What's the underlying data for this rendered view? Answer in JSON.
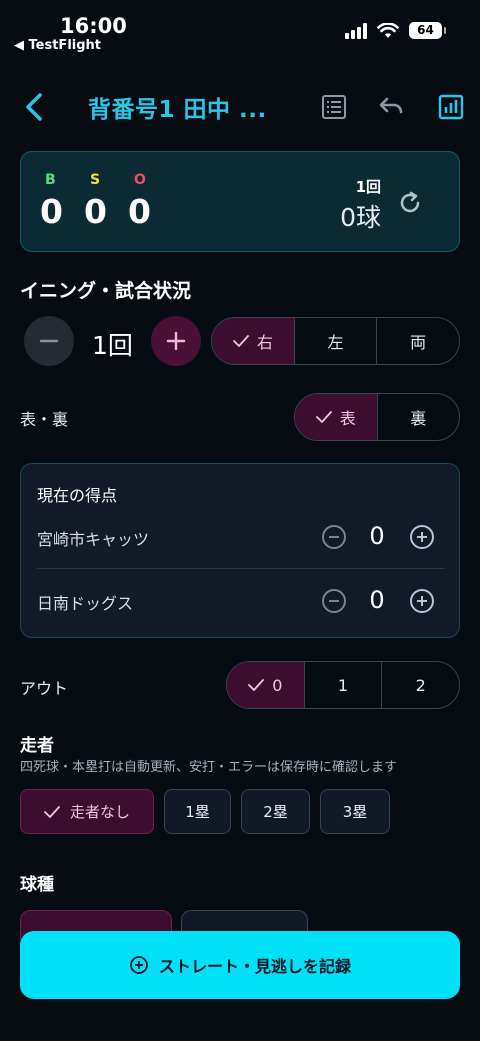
{
  "status_bar": {
    "time": "16:00",
    "back_app": "◀ TestFlight",
    "battery": "64"
  },
  "nav": {
    "title": "背番号1 田中 ..."
  },
  "score_card": {
    "ball_label": "B",
    "strike_label": "S",
    "out_label": "O",
    "balls": "0",
    "strikes": "0",
    "outs": "0",
    "inning": "1回",
    "pitch_count": "0球",
    "colors": {
      "ball": "#4be37a",
      "strike": "#f3e23b",
      "out": "#f24a6a"
    }
  },
  "inning_section": {
    "title": "イニング・試合状況",
    "value": "1回",
    "batting_side": {
      "options": [
        "右",
        "左",
        "両"
      ],
      "selected": "右"
    }
  },
  "half": {
    "label": "表・裏",
    "options": [
      "表",
      "裏"
    ],
    "selected": "表"
  },
  "current_score": {
    "title": "現在の得点",
    "teams": [
      {
        "name": "宮崎市キャッツ",
        "score": "0"
      },
      {
        "name": "日南ドッグス",
        "score": "0"
      }
    ]
  },
  "outs_section": {
    "label": "アウト",
    "options": [
      "0",
      "1",
      "2"
    ],
    "selected": "0"
  },
  "runners": {
    "title": "走者",
    "note": "四死球・本塁打は自動更新、安打・エラーは保存時に確認します",
    "options": [
      "走者なし",
      "1塁",
      "2塁",
      "3塁"
    ],
    "selected": "走者なし"
  },
  "pitch_type": {
    "title": "球種"
  },
  "record_button": {
    "label": "ストレート・見逃しを記録"
  },
  "colors": {
    "accent": "#29c6e6",
    "primary_button": "#00e1f7",
    "selected": "#3d0d30"
  }
}
